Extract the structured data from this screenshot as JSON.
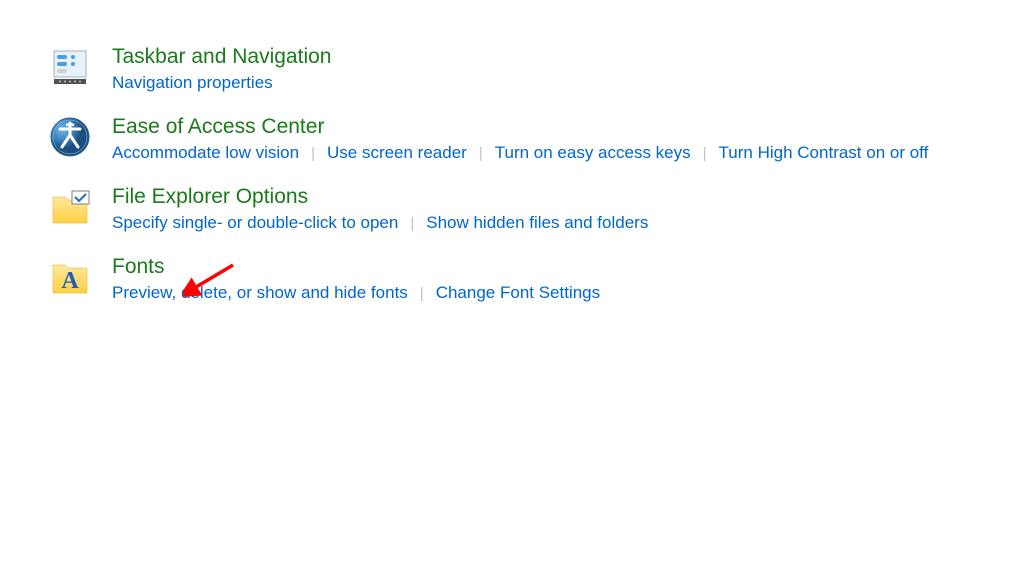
{
  "categories": [
    {
      "title": "Taskbar and Navigation",
      "links": [
        "Navigation properties"
      ]
    },
    {
      "title": "Ease of Access Center",
      "links": [
        "Accommodate low vision",
        "Use screen reader",
        "Turn on easy access keys",
        "Turn High Contrast on or off"
      ]
    },
    {
      "title": "File Explorer Options",
      "links": [
        "Specify single- or double-click to open",
        "Show hidden files and folders"
      ]
    },
    {
      "title": "Fonts",
      "links": [
        "Preview, delete, or show and hide fonts",
        "Change Font Settings"
      ]
    }
  ],
  "colors": {
    "title": "#1a7a1a",
    "link": "#0066cc",
    "arrow": "#ff0000"
  }
}
